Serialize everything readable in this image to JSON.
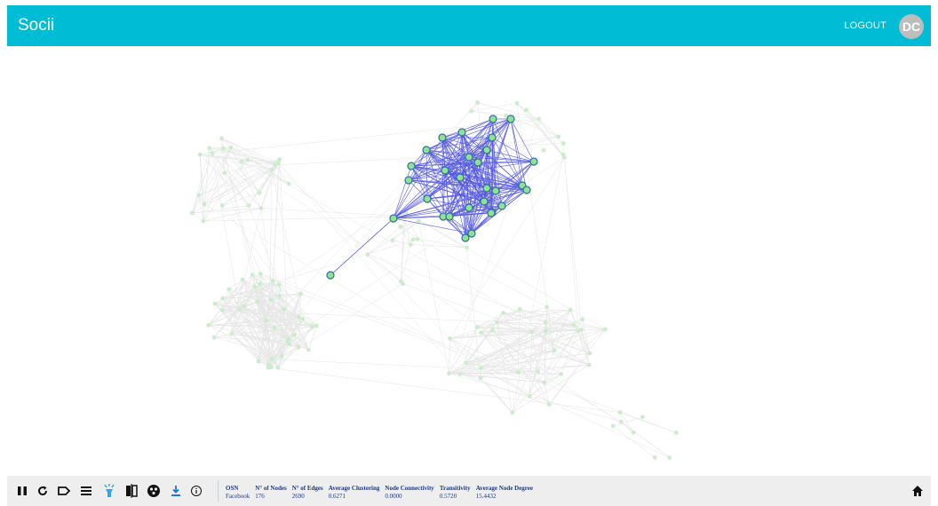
{
  "app": {
    "title": "Socii"
  },
  "header": {
    "logout_label": "LOGOUT",
    "avatar_initials": "DC"
  },
  "colors": {
    "header_bg": "#00bcd4",
    "node_fill": "#8fe38f",
    "node_stroke": "#2f6fa8",
    "edge_highlight": "#5558e0",
    "edge_faded": "#e6e6e6",
    "node_faded": "#c9eec9",
    "toolbar_bg": "#eeeeee",
    "stat_text": "#1a3a8a",
    "active_icon": "#29a9f5"
  },
  "toolbar": {
    "buttons": [
      {
        "name": "pause-icon",
        "title": "Pause"
      },
      {
        "name": "refresh-icon",
        "title": "Restart"
      },
      {
        "name": "label-icon",
        "title": "Labels"
      },
      {
        "name": "list-icon",
        "title": "List"
      },
      {
        "name": "highlight-icon",
        "title": "Highlight"
      },
      {
        "name": "compare-icon",
        "title": "Compare"
      },
      {
        "name": "community-icon",
        "title": "Communities"
      },
      {
        "name": "download-icon",
        "title": "Download"
      },
      {
        "name": "info-icon",
        "title": "Info"
      }
    ]
  },
  "stats": {
    "headers": [
      "OSN",
      "N° of Nodes",
      "N° of Edges",
      "Average Clustering",
      "Node Connectivity",
      "Transitivity",
      "Average Node Degree"
    ],
    "values": [
      "Facebook",
      "176",
      "2690",
      "0.6271",
      "0.0000",
      "0.5720",
      "15.4432"
    ]
  }
}
